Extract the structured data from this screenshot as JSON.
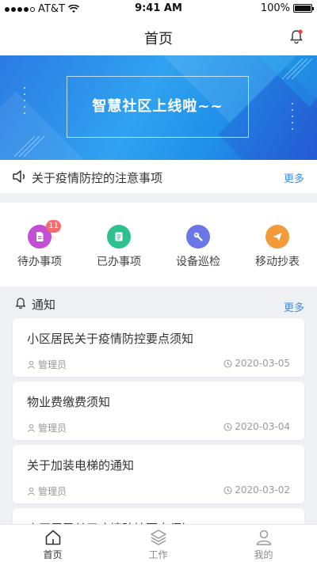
{
  "status_bar": {
    "carrier": "AT&T",
    "time": "9:41 AM",
    "battery": "100%"
  },
  "header": {
    "title": "首页"
  },
  "banner": {
    "text": "智慧社区上线啦~~"
  },
  "notice": {
    "text": "关于疫情防控的注意事项",
    "more": "更多"
  },
  "quick_actions": [
    {
      "label": "待办事项",
      "badge": "11",
      "color": "#c24fd6",
      "icon": "document-icon"
    },
    {
      "label": "已办事项",
      "badge": "",
      "color": "#2ec08e",
      "icon": "list-icon"
    },
    {
      "label": "设备巡检",
      "badge": "",
      "color": "#6b77e8",
      "icon": "wrench-icon"
    },
    {
      "label": "移动抄表",
      "badge": "",
      "color": "#f39a3b",
      "icon": "send-icon"
    }
  ],
  "notifications": {
    "title": "通知",
    "more": "更多",
    "items": [
      {
        "title": "小区居民关于疫情防控要点须知",
        "author": "管理员",
        "date": "2020-03-05"
      },
      {
        "title": "物业费缴费须知",
        "author": "管理员",
        "date": "2020-03-04"
      },
      {
        "title": "关于加装电梯的通知",
        "author": "管理员",
        "date": "2020-03-02"
      },
      {
        "title": "小区居民关于疫情防控要点须知",
        "author": "",
        "date": ""
      }
    ]
  },
  "tabbar": [
    {
      "label": "首页",
      "icon": "home-icon"
    },
    {
      "label": "工作",
      "icon": "layers-icon"
    },
    {
      "label": "我的",
      "icon": "user-icon"
    }
  ],
  "colors": {
    "accent": "#3a8ee6",
    "badge": "#f56d6d",
    "banner_start": "#2b7be3",
    "banner_end": "#2560d8"
  }
}
